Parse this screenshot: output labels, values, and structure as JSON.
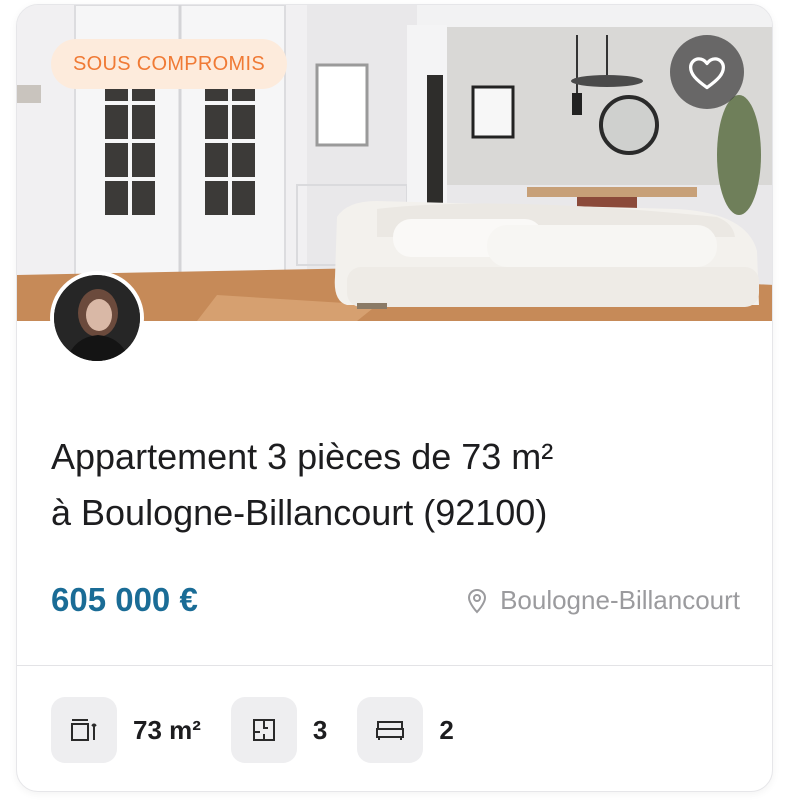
{
  "colors": {
    "badge_text": "#f07a35",
    "badge_bg": "#fdebdc",
    "price": "#1a6c96",
    "location_text": "#9b9b9e",
    "title_text": "#1d1d1f"
  },
  "listing": {
    "status_badge": "SOUS COMPROMIS",
    "title_line1": "Appartement 3 pièces de 73 m²",
    "title_line2": "à Boulogne-Billancourt (92100)",
    "price": "605 000 €",
    "location": "Boulogne-Billancourt"
  },
  "icons": {
    "favorite": "heart-icon",
    "location": "location-pin-icon",
    "surface": "surface-area-icon",
    "rooms": "floor-plan-icon",
    "bedrooms": "bed-icon"
  },
  "features": [
    {
      "icon": "surface-area-icon",
      "value": "73 m²"
    },
    {
      "icon": "floor-plan-icon",
      "value": "3"
    },
    {
      "icon": "bed-icon",
      "value": "2"
    }
  ]
}
